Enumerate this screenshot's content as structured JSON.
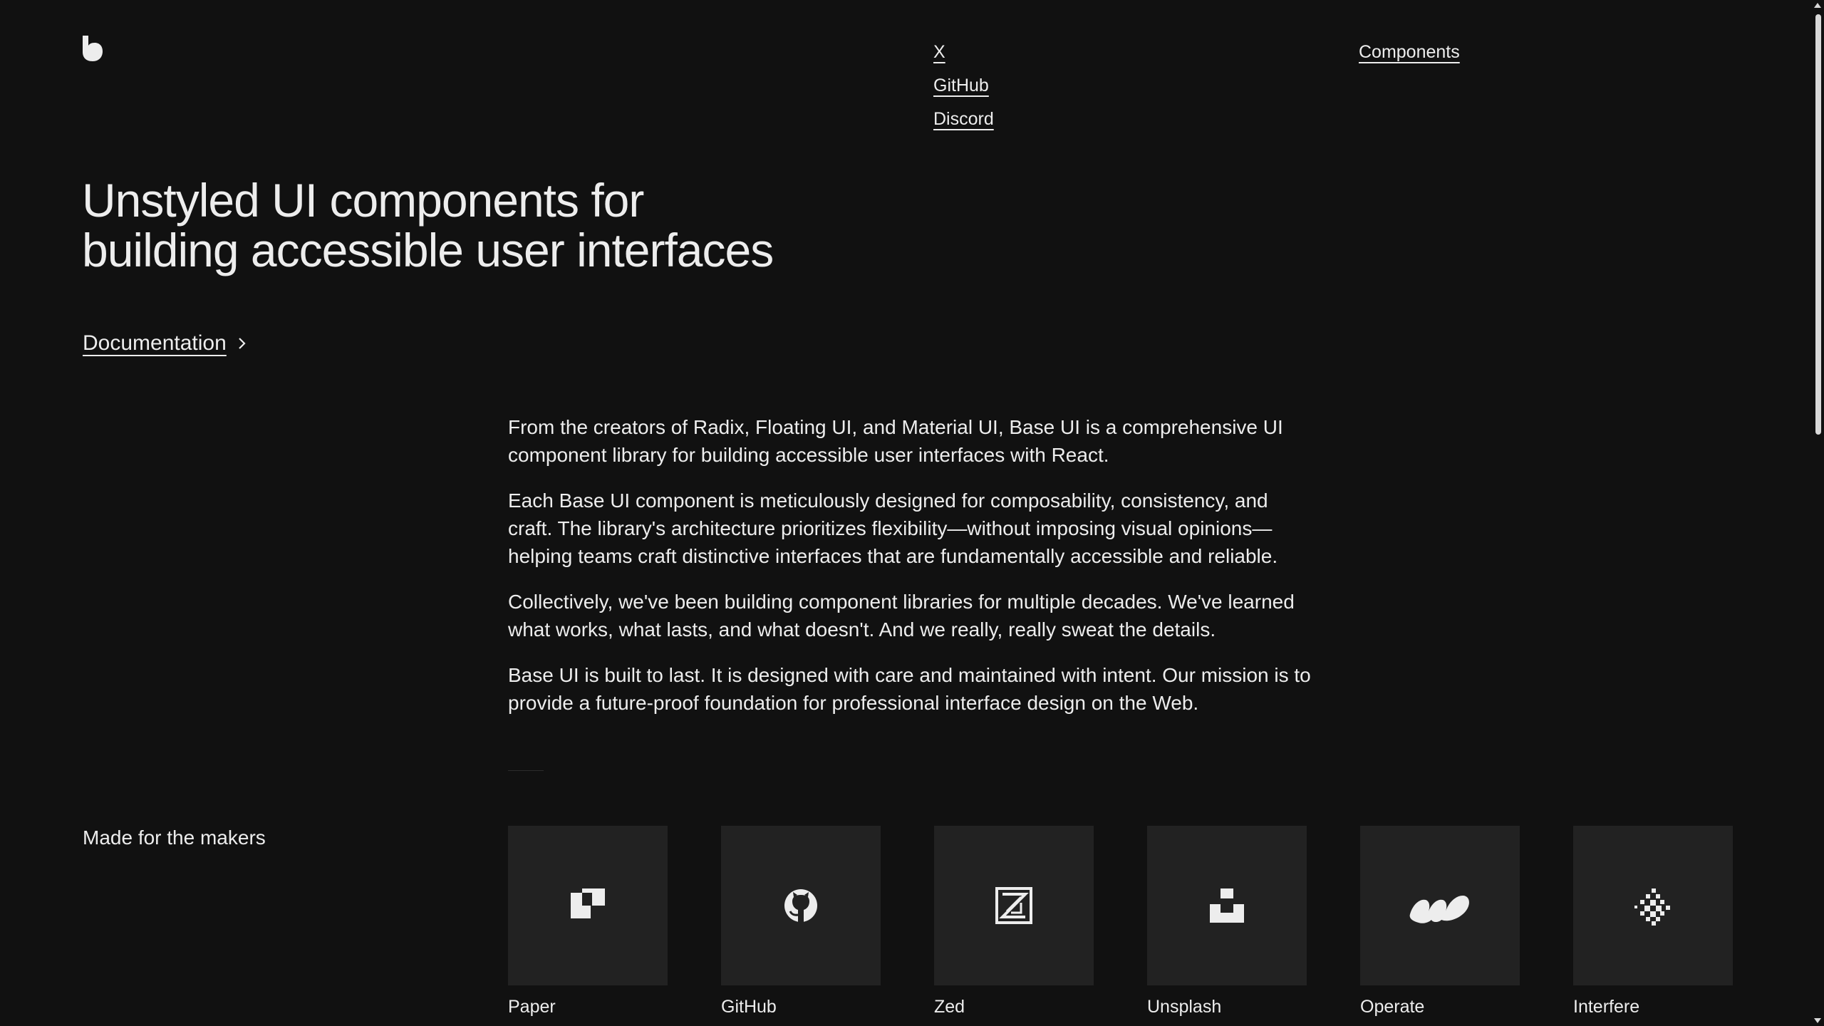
{
  "brand": {
    "logo": "base-ui-logo-icon"
  },
  "nav": {
    "social": [
      {
        "label": "X"
      },
      {
        "label": "GitHub"
      },
      {
        "label": "Discord"
      }
    ],
    "main": [
      {
        "label": "Components"
      }
    ]
  },
  "hero": {
    "title_line1": "Unstyled UI components for",
    "title_line2": "building accessible user interfaces",
    "doc_link": "Documentation"
  },
  "intro": [
    "From the creators of Radix, Floating UI, and Material UI, Base UI is a comprehensive UI component library for building accessible user interfaces with React.",
    "Each Base UI component is meticulously designed for composability, consistency, and craft. The library's architecture prioritizes flexibility—without imposing visual opinions—helping teams craft distinctive interfaces that are fundamentally accessible and reliable.",
    "Collectively, we've been building component libraries for multiple decades. We've learned what works, what lasts, and what doesn't. And we really, really sweat the details.",
    "Base UI is built to last. It is designed with care and maintained with intent. Our mission is to provide a future-proof foundation for professional interface design on the Web."
  ],
  "makers": {
    "label": "Made for the makers",
    "items": [
      {
        "name": "Paper",
        "icon": "paper-logo-icon"
      },
      {
        "name": "GitHub",
        "icon": "github-logo-icon"
      },
      {
        "name": "Zed",
        "icon": "zed-logo-icon"
      },
      {
        "name": "Unsplash",
        "icon": "unsplash-logo-icon"
      },
      {
        "name": "Operate",
        "icon": "operate-logo-icon"
      },
      {
        "name": "Interfere",
        "icon": "interfere-logo-icon"
      }
    ]
  },
  "colors": {
    "background": "#111111",
    "text": "#ededed",
    "tile": "#222222"
  }
}
